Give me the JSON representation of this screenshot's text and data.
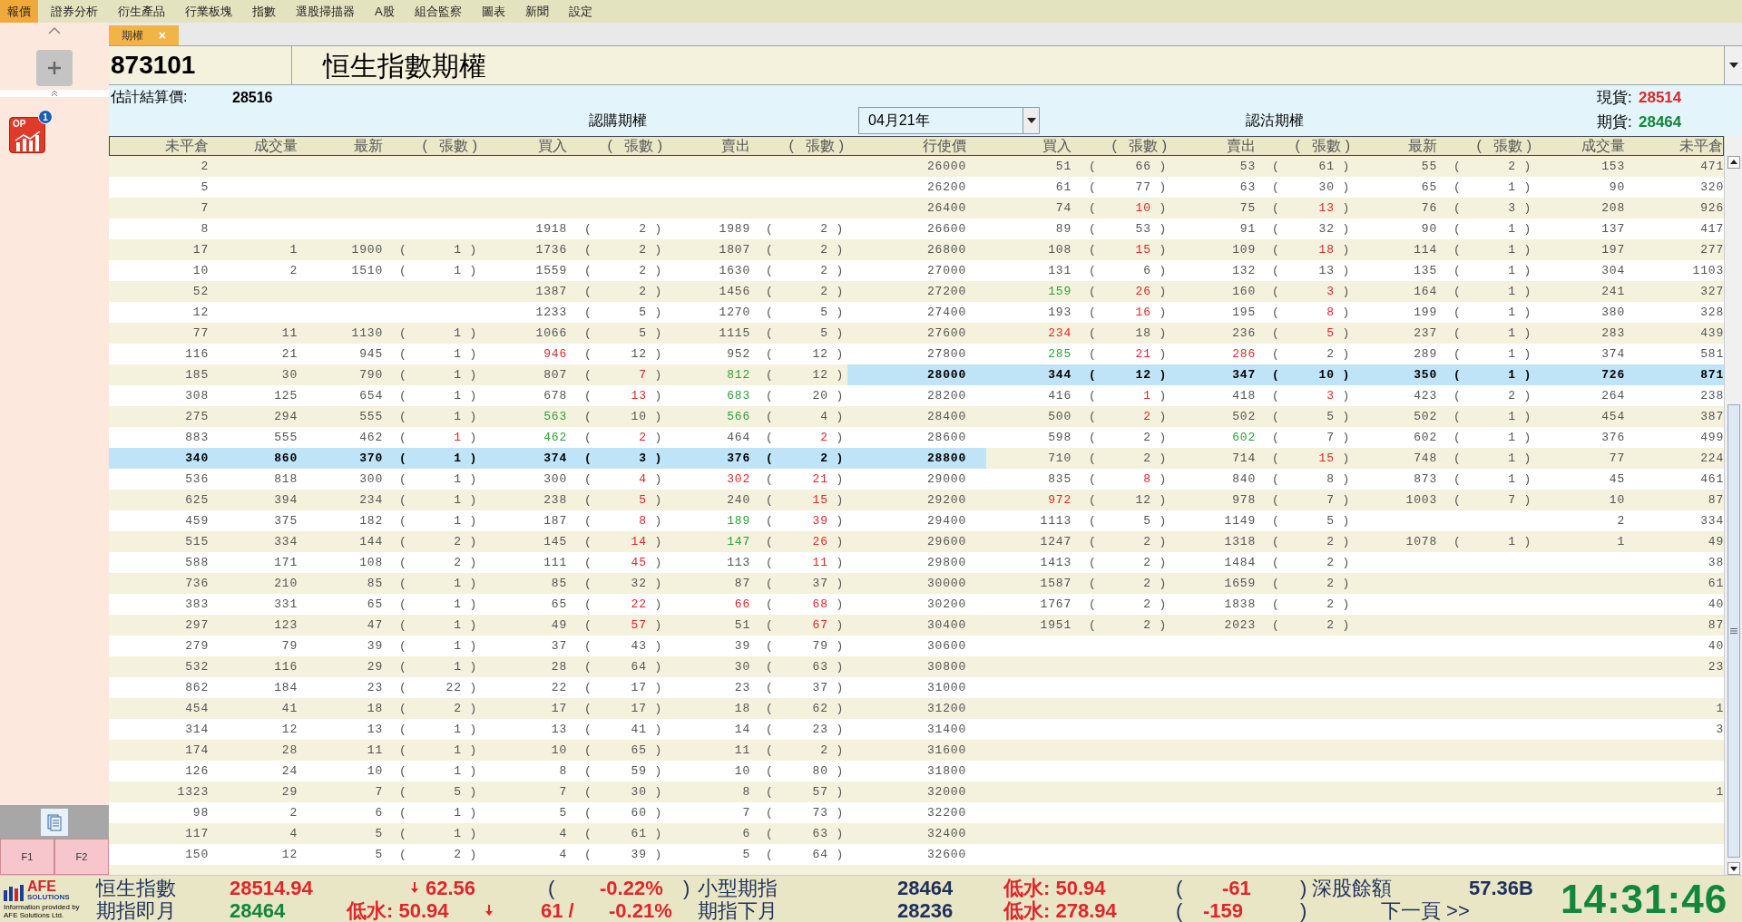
{
  "menu": [
    {
      "label": "報價",
      "selected": true
    },
    {
      "label": "證券分析",
      "selected": false
    },
    {
      "label": "衍生產品",
      "selected": false
    },
    {
      "label": "行業板塊",
      "selected": false
    },
    {
      "label": "指數",
      "selected": false
    },
    {
      "label": "選股掃描器",
      "selected": false
    },
    {
      "label": "A股",
      "selected": false
    },
    {
      "label": "組合監察",
      "selected": false
    },
    {
      "label": "圖表",
      "selected": false
    },
    {
      "label": "新聞",
      "selected": false
    },
    {
      "label": "設定",
      "selected": false
    }
  ],
  "sidebar": {
    "apps": [
      {
        "label": "OP",
        "badge": "1"
      }
    ],
    "function_keys": [
      "F1",
      "F2"
    ]
  },
  "tabs": [
    {
      "label": "期權",
      "selected": true,
      "close": "×"
    }
  ],
  "code": "873101",
  "product": "恒生指數期權",
  "info": {
    "settlement_label": "估計結算價:",
    "settlement": "28516",
    "call_title": "認購期權",
    "put_title": "認沽期權",
    "expiry": "04月21年",
    "spot_label": "現貨:",
    "spot": "28514",
    "futures_label": "期貨:",
    "futures": "28464"
  },
  "brackets": {
    "open": "(",
    "close": ")"
  },
  "columns": {
    "call": [
      "未平倉",
      "成交量",
      "最新",
      "張數",
      "買入",
      "張數",
      "賣出",
      "張數"
    ],
    "strike": "行使價",
    "put": [
      "買入",
      "張數",
      "賣出",
      "張數",
      "最新",
      "張數",
      "成交量",
      "未平倉"
    ]
  },
  "rows": [
    {
      "call": {
        "oi": "2"
      },
      "strike": "26000",
      "put": {
        "bid": "51",
        "bid_qty": "66",
        "ask": "53",
        "ask_qty": "61",
        "last": "55",
        "last_qty": "2",
        "volume": "153",
        "oi": "471"
      },
      "call_selected": false,
      "put_selected": false
    },
    {
      "call": {
        "oi": "5"
      },
      "strike": "26200",
      "put": {
        "bid": "61",
        "bid_qty": "77",
        "ask": "63",
        "ask_qty": "30",
        "last": "65",
        "last_qty": "1",
        "volume": "90",
        "oi": "320"
      },
      "call_selected": false,
      "put_selected": false
    },
    {
      "call": {
        "oi": "7"
      },
      "strike": "26400",
      "put": {
        "bid": "74",
        "bid_qty": {
          "text": "10",
          "color": "#e0262b"
        },
        "ask": "75",
        "ask_qty": {
          "text": "13",
          "color": "#e0262b"
        },
        "last": "76",
        "last_qty": "3",
        "volume": "208",
        "oi": "926"
      },
      "call_selected": false,
      "put_selected": false
    },
    {
      "call": {
        "oi": "8",
        "bid": "1918",
        "bid_qty": "2",
        "ask": "1989",
        "ask_qty": "2"
      },
      "strike": "26600",
      "put": {
        "bid": "89",
        "bid_qty": "53",
        "ask": "91",
        "ask_qty": "32",
        "last": "90",
        "last_qty": "1",
        "volume": "137",
        "oi": "417"
      },
      "call_selected": false,
      "put_selected": false
    },
    {
      "call": {
        "oi": "17",
        "volume": "1",
        "last": "1900",
        "last_qty": "1",
        "bid": "1736",
        "bid_qty": "2",
        "ask": "1807",
        "ask_qty": "2"
      },
      "strike": "26800",
      "put": {
        "bid": "108",
        "bid_qty": {
          "text": "15",
          "color": "#e0262b"
        },
        "ask": "109",
        "ask_qty": {
          "text": "18",
          "color": "#e0262b"
        },
        "last": "114",
        "last_qty": "1",
        "volume": "197",
        "oi": "277"
      },
      "call_selected": false,
      "put_selected": false
    },
    {
      "call": {
        "oi": "10",
        "volume": "2",
        "last": "1510",
        "last_qty": "1",
        "bid": "1559",
        "bid_qty": "2",
        "ask": "1630",
        "ask_qty": "2"
      },
      "strike": "27000",
      "put": {
        "bid": "131",
        "bid_qty": "6",
        "ask": "132",
        "ask_qty": "13",
        "last": "135",
        "last_qty": "1",
        "volume": "304",
        "oi": "1103"
      },
      "call_selected": false,
      "put_selected": false
    },
    {
      "call": {
        "oi": "52",
        "bid": "1387",
        "bid_qty": "2",
        "ask": "1456",
        "ask_qty": "2"
      },
      "strike": "27200",
      "put": {
        "bid": {
          "text": "159",
          "color": "#2e9e3e"
        },
        "bid_qty": {
          "text": "26",
          "color": "#e0262b"
        },
        "ask": "160",
        "ask_qty": {
          "text": "3",
          "color": "#e0262b"
        },
        "last": "164",
        "last_qty": "1",
        "volume": "241",
        "oi": "327"
      },
      "call_selected": false,
      "put_selected": false
    },
    {
      "call": {
        "oi": "12",
        "bid": "1233",
        "bid_qty": "5",
        "ask": "1270",
        "ask_qty": "5"
      },
      "strike": "27400",
      "put": {
        "bid": "193",
        "bid_qty": {
          "text": "16",
          "color": "#e0262b"
        },
        "ask": "195",
        "ask_qty": {
          "text": "8",
          "color": "#e0262b"
        },
        "last": "199",
        "last_qty": "1",
        "volume": "380",
        "oi": "328"
      },
      "call_selected": false,
      "put_selected": false
    },
    {
      "call": {
        "oi": "77",
        "volume": "11",
        "last": "1130",
        "last_qty": "1",
        "bid": "1066",
        "bid_qty": "5",
        "ask": "1115",
        "ask_qty": "5"
      },
      "strike": "27600",
      "put": {
        "bid": {
          "text": "234",
          "color": "#e0262b"
        },
        "bid_qty": "18",
        "ask": "236",
        "ask_qty": {
          "text": "5",
          "color": "#e0262b"
        },
        "last": "237",
        "last_qty": "1",
        "volume": "283",
        "oi": "439"
      },
      "call_selected": false,
      "put_selected": false
    },
    {
      "call": {
        "oi": "116",
        "volume": "21",
        "last": "945",
        "last_qty": "1",
        "bid": {
          "text": "946",
          "color": "#e0262b"
        },
        "bid_qty": "12",
        "ask": "952",
        "ask_qty": "12"
      },
      "strike": "27800",
      "put": {
        "bid": {
          "text": "285",
          "color": "#2e9e3e"
        },
        "bid_qty": {
          "text": "21",
          "color": "#e0262b"
        },
        "ask": {
          "text": "286",
          "color": "#e0262b"
        },
        "ask_qty": "2",
        "last": "289",
        "last_qty": "1",
        "volume": "374",
        "oi": "581"
      },
      "call_selected": false,
      "put_selected": false
    },
    {
      "call": {
        "oi": "185",
        "volume": "30",
        "last": "790",
        "last_qty": "1",
        "bid": "807",
        "bid_qty": {
          "text": "7",
          "color": "#e0262b"
        },
        "ask": {
          "text": "812",
          "color": "#2e9e3e"
        },
        "ask_qty": "12"
      },
      "strike": "28000",
      "put": {
        "bid": "344",
        "bid_qty": "12",
        "ask": "347",
        "ask_qty": "10",
        "last": "350",
        "last_qty": "1",
        "volume": "726",
        "oi": "871"
      },
      "call_selected": false,
      "put_selected": true
    },
    {
      "call": {
        "oi": "308",
        "volume": "125",
        "last": "654",
        "last_qty": "1",
        "bid": "678",
        "bid_qty": {
          "text": "13",
          "color": "#e0262b"
        },
        "ask": {
          "text": "683",
          "color": "#2e9e3e"
        },
        "ask_qty": "20"
      },
      "strike": "28200",
      "put": {
        "bid": "416",
        "bid_qty": {
          "text": "1",
          "color": "#e0262b"
        },
        "ask": "418",
        "ask_qty": {
          "text": "3",
          "color": "#e0262b"
        },
        "last": "423",
        "last_qty": "2",
        "volume": "264",
        "oi": "238"
      },
      "call_selected": false,
      "put_selected": false
    },
    {
      "call": {
        "oi": "275",
        "volume": "294",
        "last": "555",
        "last_qty": "1",
        "bid": {
          "text": "563",
          "color": "#2e9e3e"
        },
        "bid_qty": "10",
        "ask": {
          "text": "566",
          "color": "#2e9e3e"
        },
        "ask_qty": "4"
      },
      "strike": "28400",
      "put": {
        "bid": "500",
        "bid_qty": {
          "text": "2",
          "color": "#e0262b"
        },
        "ask": "502",
        "ask_qty": "5",
        "last": "502",
        "last_qty": "1",
        "volume": "454",
        "oi": "387"
      },
      "call_selected": false,
      "put_selected": false
    },
    {
      "call": {
        "oi": "883",
        "volume": "555",
        "last": "462",
        "last_qty": {
          "text": "1",
          "color": "#e0262b"
        },
        "bid": {
          "text": "462",
          "color": "#2e9e3e"
        },
        "bid_qty": {
          "text": "2",
          "color": "#e0262b"
        },
        "ask": "464",
        "ask_qty": {
          "text": "2",
          "color": "#e0262b"
        }
      },
      "strike": "28600",
      "put": {
        "bid": "598",
        "bid_qty": "2",
        "ask": {
          "text": "602",
          "color": "#2e9e3e"
        },
        "ask_qty": "7",
        "last": "602",
        "last_qty": "1",
        "volume": "376",
        "oi": "499"
      },
      "call_selected": false,
      "put_selected": false
    },
    {
      "call": {
        "oi": "340",
        "volume": "860",
        "last": "370",
        "last_qty": "1",
        "bid": "374",
        "bid_qty": "3",
        "ask": "376",
        "ask_qty": "2"
      },
      "strike": "28800",
      "put": {
        "bid": "710",
        "bid_qty": "2",
        "ask": "714",
        "ask_qty": {
          "text": "15",
          "color": "#e0262b"
        },
        "last": "748",
        "last_qty": "1",
        "volume": "77",
        "oi": "224"
      },
      "call_selected": true,
      "put_selected": false
    },
    {
      "call": {
        "oi": "536",
        "volume": "818",
        "last": "300",
        "last_qty": "1",
        "bid": "300",
        "bid_qty": {
          "text": "4",
          "color": "#e0262b"
        },
        "ask": {
          "text": "302",
          "color": "#e0262b"
        },
        "ask_qty": {
          "text": "21",
          "color": "#e0262b"
        }
      },
      "strike": "29000",
      "put": {
        "bid": "835",
        "bid_qty": {
          "text": "8",
          "color": "#e0262b"
        },
        "ask": "840",
        "ask_qty": "8",
        "last": "873",
        "last_qty": "1",
        "volume": "45",
        "oi": "461"
      },
      "call_selected": false,
      "put_selected": false
    },
    {
      "call": {
        "oi": "625",
        "volume": "394",
        "last": "234",
        "last_qty": "1",
        "bid": "238",
        "bid_qty": {
          "text": "5",
          "color": "#e0262b"
        },
        "ask": "240",
        "ask_qty": {
          "text": "15",
          "color": "#e0262b"
        }
      },
      "strike": "29200",
      "put": {
        "bid": {
          "text": "972",
          "color": "#e0262b"
        },
        "bid_qty": "12",
        "ask": "978",
        "ask_qty": "7",
        "last": "1003",
        "last_qty": "7",
        "volume": "10",
        "oi": "87"
      },
      "call_selected": false,
      "put_selected": false
    },
    {
      "call": {
        "oi": "459",
        "volume": "375",
        "last": "182",
        "last_qty": "1",
        "bid": "187",
        "bid_qty": {
          "text": "8",
          "color": "#e0262b"
        },
        "ask": {
          "text": "189",
          "color": "#2e9e3e"
        },
        "ask_qty": {
          "text": "39",
          "color": "#e0262b"
        }
      },
      "strike": "29400",
      "put": {
        "bid": "1113",
        "bid_qty": "5",
        "ask": "1149",
        "ask_qty": "5",
        "volume": "2",
        "oi": "334"
      },
      "call_selected": false,
      "put_selected": false
    },
    {
      "call": {
        "oi": "515",
        "volume": "334",
        "last": "144",
        "last_qty": "2",
        "bid": "145",
        "bid_qty": {
          "text": "14",
          "color": "#e0262b"
        },
        "ask": {
          "text": "147",
          "color": "#2e9e3e"
        },
        "ask_qty": {
          "text": "26",
          "color": "#e0262b"
        }
      },
      "strike": "29600",
      "put": {
        "bid": "1247",
        "bid_qty": "2",
        "ask": "1318",
        "ask_qty": "2",
        "last": "1078",
        "last_qty": "1",
        "volume": "1",
        "oi": "49"
      },
      "call_selected": false,
      "put_selected": false
    },
    {
      "call": {
        "oi": "588",
        "volume": "171",
        "last": "108",
        "last_qty": "2",
        "bid": "111",
        "bid_qty": {
          "text": "45",
          "color": "#e0262b"
        },
        "ask": "113",
        "ask_qty": {
          "text": "11",
          "color": "#e0262b"
        }
      },
      "strike": "29800",
      "put": {
        "bid": "1413",
        "bid_qty": "2",
        "ask": "1484",
        "ask_qty": "2",
        "oi": "38"
      },
      "call_selected": false,
      "put_selected": false
    },
    {
      "call": {
        "oi": "736",
        "volume": "210",
        "last": "85",
        "last_qty": "1",
        "bid": "85",
        "bid_qty": "32",
        "ask": "87",
        "ask_qty": "37"
      },
      "strike": "30000",
      "put": {
        "bid": "1587",
        "bid_qty": "2",
        "ask": "1659",
        "ask_qty": "2",
        "oi": "61"
      },
      "call_selected": false,
      "put_selected": false
    },
    {
      "call": {
        "oi": "383",
        "volume": "331",
        "last": "65",
        "last_qty": "1",
        "bid": "65",
        "bid_qty": {
          "text": "22",
          "color": "#e0262b"
        },
        "ask": {
          "text": "66",
          "color": "#e0262b"
        },
        "ask_qty": {
          "text": "68",
          "color": "#e0262b"
        }
      },
      "strike": "30200",
      "put": {
        "bid": "1767",
        "bid_qty": "2",
        "ask": "1838",
        "ask_qty": "2",
        "oi": "40"
      },
      "call_selected": false,
      "put_selected": false
    },
    {
      "call": {
        "oi": "297",
        "volume": "123",
        "last": "47",
        "last_qty": "1",
        "bid": "49",
        "bid_qty": {
          "text": "57",
          "color": "#e0262b"
        },
        "ask": "51",
        "ask_qty": {
          "text": "67",
          "color": "#e0262b"
        }
      },
      "strike": "30400",
      "put": {
        "bid": "1951",
        "bid_qty": "2",
        "ask": "2023",
        "ask_qty": "2",
        "oi": "87"
      },
      "call_selected": false,
      "put_selected": false
    },
    {
      "call": {
        "oi": "279",
        "volume": "79",
        "last": "39",
        "last_qty": "1",
        "bid": "37",
        "bid_qty": "43",
        "ask": "39",
        "ask_qty": "79"
      },
      "strike": "30600",
      "put": {
        "oi": "40"
      },
      "call_selected": false,
      "put_selected": false
    },
    {
      "call": {
        "oi": "532",
        "volume": "116",
        "last": "29",
        "last_qty": "1",
        "bid": "28",
        "bid_qty": "64",
        "ask": "30",
        "ask_qty": "63"
      },
      "strike": "30800",
      "put": {
        "oi": "23"
      },
      "call_selected": false,
      "put_selected": false
    },
    {
      "call": {
        "oi": "862",
        "volume": "184",
        "last": "23",
        "last_qty": "22",
        "bid": "22",
        "bid_qty": "17",
        "ask": "23",
        "ask_qty": "37"
      },
      "strike": "31000",
      "call_selected": false,
      "put_selected": false
    },
    {
      "call": {
        "oi": "454",
        "volume": "41",
        "last": "18",
        "last_qty": "2",
        "bid": "17",
        "bid_qty": "17",
        "ask": "18",
        "ask_qty": "62"
      },
      "strike": "31200",
      "put": {
        "oi": "1"
      },
      "call_selected": false,
      "put_selected": false
    },
    {
      "call": {
        "oi": "314",
        "volume": "12",
        "last": "13",
        "last_qty": "1",
        "bid": "13",
        "bid_qty": "41",
        "ask": "14",
        "ask_qty": "23"
      },
      "strike": "31400",
      "put": {
        "oi": "3"
      },
      "call_selected": false,
      "put_selected": false
    },
    {
      "call": {
        "oi": "174",
        "volume": "28",
        "last": "11",
        "last_qty": "1",
        "bid": "10",
        "bid_qty": "65",
        "ask": "11",
        "ask_qty": "2"
      },
      "strike": "31600",
      "call_selected": false,
      "put_selected": false
    },
    {
      "call": {
        "oi": "126",
        "volume": "24",
        "last": "10",
        "last_qty": "1",
        "bid": "8",
        "bid_qty": "59",
        "ask": "10",
        "ask_qty": "80"
      },
      "strike": "31800",
      "call_selected": false,
      "put_selected": false
    },
    {
      "call": {
        "oi": "1323",
        "volume": "29",
        "last": "7",
        "last_qty": "5",
        "bid": "7",
        "bid_qty": "30",
        "ask": "8",
        "ask_qty": "57"
      },
      "strike": "32000",
      "put": {
        "oi": "1"
      },
      "call_selected": false,
      "put_selected": false
    },
    {
      "call": {
        "oi": "98",
        "volume": "2",
        "last": "6",
        "last_qty": "1",
        "bid": "5",
        "bid_qty": "60",
        "ask": "7",
        "ask_qty": "73"
      },
      "strike": "32200",
      "call_selected": false,
      "put_selected": false
    },
    {
      "call": {
        "oi": "117",
        "volume": "4",
        "last": "5",
        "last_qty": "1",
        "bid": "4",
        "bid_qty": "61",
        "ask": "6",
        "ask_qty": "63"
      },
      "strike": "32400",
      "call_selected": false,
      "put_selected": false
    },
    {
      "call": {
        "oi": "150",
        "volume": "12",
        "last": "5",
        "last_qty": "2",
        "bid": "4",
        "bid_qty": "39",
        "ask": "5",
        "ask_qty": "64"
      },
      "strike": "32600",
      "call_selected": false,
      "put_selected": false
    }
  ],
  "footer": {
    "logo": "AFE",
    "logo_sub": "SOLUTIONS",
    "caption": "Information provided by AFE Solutions Ltd.",
    "clock": "14:31:46",
    "lines": [
      [
        {
          "kind": "text",
          "text": "恒生指數",
          "color": "#1d2f5c",
          "bold": false
        },
        {
          "kind": "text",
          "text": "28514.94",
          "color": "#e0262b",
          "bold": true
        },
        {
          "kind": "arrow",
          "color": "#e0262b"
        },
        {
          "kind": "text",
          "text": "62.56",
          "color": "#e0262b",
          "bold": true
        },
        {
          "kind": "text",
          "text": "(",
          "color": "#1d2f5c",
          "bold": false
        },
        {
          "kind": "text",
          "text": "-0.22%",
          "color": "#e0262b",
          "bold": true
        },
        {
          "kind": "text",
          "text": ")",
          "color": "#1d2f5c",
          "bold": false
        },
        {
          "kind": "text",
          "text": "小型期指",
          "color": "#1d2f5c",
          "bold": false
        },
        {
          "kind": "text",
          "text": "28464",
          "color": "#1d2f5c",
          "bold": true
        },
        {
          "kind": "text",
          "text": "低水: 50.94",
          "color": "#e0262b",
          "bold": true
        },
        {
          "kind": "text",
          "text": "(",
          "color": "#1d2f5c",
          "bold": false
        },
        {
          "kind": "text",
          "text": "-61",
          "color": "#e0262b",
          "bold": true
        },
        {
          "kind": "text",
          "text": ")",
          "color": "#1d2f5c",
          "bold": false
        },
        {
          "kind": "text",
          "text": "深股餘額",
          "color": "#1d2f5c",
          "bold": false
        },
        {
          "kind": "text",
          "text": "57.36B",
          "color": "#1d2f5c",
          "bold": true
        }
      ],
      [
        {
          "kind": "text",
          "text": "期指即月",
          "color": "#1d2f5c",
          "bold": false
        },
        {
          "kind": "text",
          "text": "28464",
          "color": "#12873a",
          "bold": true
        },
        {
          "kind": "text",
          "text": "低水: 50.94",
          "color": "#e0262b",
          "bold": true
        },
        {
          "kind": "arrow",
          "color": "#e0262b"
        },
        {
          "kind": "text",
          "text": "61 /",
          "color": "#e0262b",
          "bold": true
        },
        {
          "kind": "text",
          "text": "-0.21%",
          "color": "#e0262b",
          "bold": true
        },
        {
          "kind": "text",
          "text": "期指下月",
          "color": "#1d2f5c",
          "bold": false
        },
        {
          "kind": "text",
          "text": "28236",
          "color": "#1d2f5c",
          "bold": true
        },
        {
          "kind": "text",
          "text": "低水: 278.94",
          "color": "#e0262b",
          "bold": true
        },
        {
          "kind": "text",
          "text": "(",
          "color": "#1d2f5c",
          "bold": false
        },
        {
          "kind": "text",
          "text": "-159",
          "color": "#e0262b",
          "bold": true
        },
        {
          "kind": "text",
          "text": ")",
          "color": "#1d2f5c",
          "bold": false
        },
        {
          "kind": "link",
          "text": "下一頁 >>",
          "color": "#1d2f5c",
          "bold": false
        }
      ]
    ]
  }
}
